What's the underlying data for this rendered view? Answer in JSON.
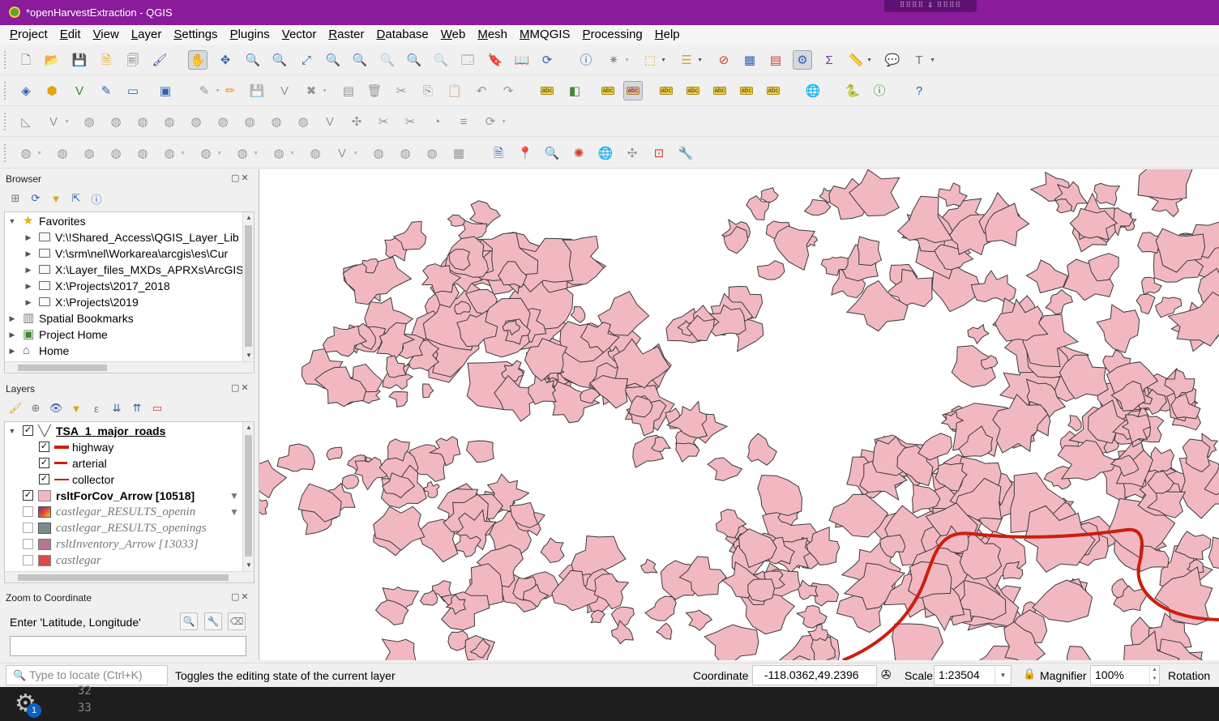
{
  "window": {
    "title": "*openHarvestExtraction - QGIS",
    "grip": "⠿⠿⠿⠿  ⇓  ⠿⠿⠿⠿"
  },
  "menu": [
    "Project",
    "Edit",
    "View",
    "Layer",
    "Settings",
    "Plugins",
    "Vector",
    "Raster",
    "Database",
    "Web",
    "Mesh",
    "MMQGIS",
    "Processing",
    "Help"
  ],
  "toolbars": {
    "row1": [
      "new-project",
      "open-project",
      "save-project",
      "new-print-layout",
      "layout-manager",
      "style-manager",
      "pan-map",
      "pan-to-selection",
      "zoom-in",
      "zoom-out",
      "zoom-full",
      "zoom-to-selection",
      "zoom-to-layer",
      "zoom-native",
      "zoom-last",
      "zoom-next",
      "new-map-view",
      "new-bookmark",
      "show-bookmarks",
      "refresh",
      "identify",
      "measure-tools",
      "select-features",
      "deselect",
      "open-attribute-table",
      "statistical-summary",
      "show-layout",
      "toggle-settings",
      "field-calculator",
      "measure-line",
      "map-tips",
      "text-annotation"
    ],
    "row2": [
      "data-source-manager",
      "new-geopackage",
      "new-shapefile",
      "new-temporary-layer",
      "add-virtual-layer",
      "digitize",
      "current-edits",
      "toggle-editing",
      "save-edits",
      "add-feature",
      "vertex-tool",
      "delete-selected",
      "cut",
      "copy",
      "paste",
      "undo",
      "redo",
      "label-tool",
      "diagram",
      "pin-labels",
      "highlight-labels",
      "show-hide-labels",
      "move-label",
      "rotate-label",
      "change-label",
      "plugins",
      "python-console",
      "metasearch",
      "help"
    ],
    "row3_count": 18,
    "row4": [
      "georeferencer",
      "add-point",
      "zoom-to-point",
      "identify-features",
      "globe",
      "xy-tool",
      "select-region",
      "settings-wrench"
    ]
  },
  "browser": {
    "title": "Browser",
    "items": [
      {
        "label": "Favorites",
        "level": 0,
        "type": "star",
        "expanded": true
      },
      {
        "label": "V:\\!Shared_Access\\QGIS_Layer_Lib",
        "level": 1,
        "type": "folder"
      },
      {
        "label": "V:\\srm\\nel\\Workarea\\arcgis\\es\\Cur",
        "level": 1,
        "type": "folder"
      },
      {
        "label": "X:\\Layer_files_MXDs_APRXs\\ArcGIS",
        "level": 1,
        "type": "folder"
      },
      {
        "label": "X:\\Projects\\2017_2018",
        "level": 1,
        "type": "folder"
      },
      {
        "label": "X:\\Projects\\2019",
        "level": 1,
        "type": "folder"
      },
      {
        "label": "Spatial Bookmarks",
        "level": 0,
        "type": "bookmark"
      },
      {
        "label": "Project Home",
        "level": 0,
        "type": "home-project"
      },
      {
        "label": "Home",
        "level": 0,
        "type": "home"
      }
    ]
  },
  "layers": {
    "title": "Layers",
    "items": [
      {
        "label": "TSA_1_major_roads",
        "style": "bold-underline",
        "checked": true,
        "symbol": "line-group",
        "level": 0,
        "expand": true
      },
      {
        "label": "highway",
        "style": "normal",
        "checked": true,
        "symbol": "red-thick",
        "level": 1
      },
      {
        "label": "arterial",
        "style": "normal",
        "checked": true,
        "symbol": "red-medium",
        "level": 1
      },
      {
        "label": "collector",
        "style": "normal",
        "checked": true,
        "symbol": "red-thin",
        "level": 1
      },
      {
        "label": "rsltForCov_Arrow [10518]",
        "style": "bold",
        "checked": true,
        "symbol": "pink-fill",
        "level": 0,
        "filter": true
      },
      {
        "label": "castlegar_RESULTS_openin",
        "style": "italic",
        "checked": false,
        "symbol": "gradient",
        "level": 0,
        "filter": true
      },
      {
        "label": "castlegar_RESULTS_openings",
        "style": "italic",
        "checked": false,
        "symbol": "gray-fill",
        "level": 0
      },
      {
        "label": "rsltInventory_Arrow [13033]",
        "style": "italic",
        "checked": false,
        "symbol": "mauve-fill",
        "level": 0
      },
      {
        "label": "castlegar",
        "style": "italic",
        "checked": false,
        "symbol": "red-fill",
        "level": 0
      }
    ]
  },
  "zoom_panel": {
    "title": "Zoom to Coordinate",
    "label": "Enter 'Latitude, Longitude'",
    "value": ""
  },
  "statusbar": {
    "locator_placeholder": "Type to locate (Ctrl+K)",
    "message": "Toggles the editing state of the current layer",
    "coordinate_label": "Coordinate",
    "coordinate": "-118.0362,49.2396",
    "scale_label": "Scale",
    "scale": "1:23504",
    "magnifier_label": "Magnifier",
    "magnifier": "100%",
    "rotation_label": "Rotation"
  },
  "taskbar": {
    "badge": "1",
    "lines": [
      "32",
      "33"
    ]
  },
  "colors": {
    "title_bg": "#8a1b9a",
    "polygon_fill": "#f2b8c2",
    "polygon_stroke": "#3a3a3a",
    "road": "#cc1e0e"
  }
}
